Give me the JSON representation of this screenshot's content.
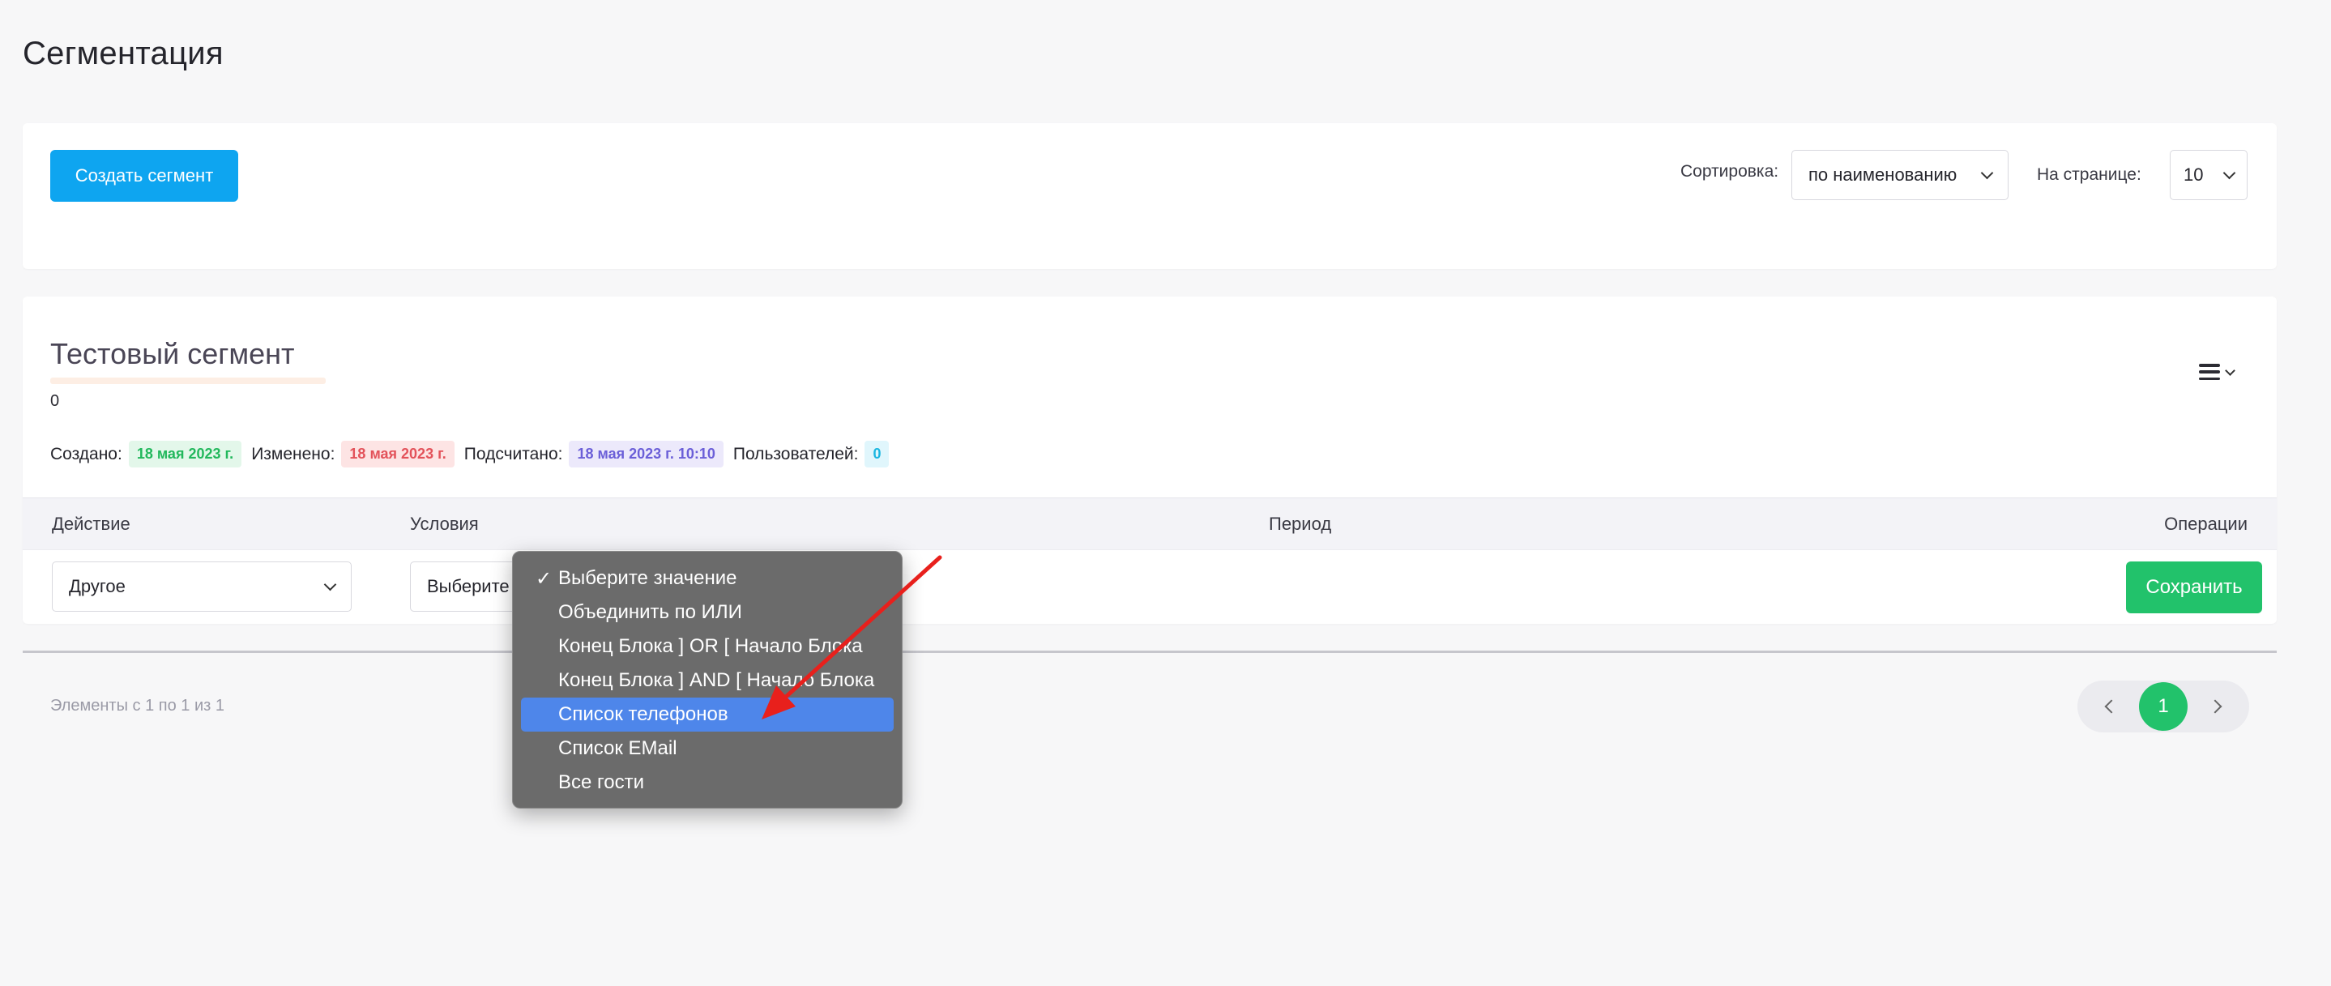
{
  "page": {
    "title": "Сегментация"
  },
  "toolbar": {
    "create_button": "Создать сегмент",
    "sort_label": "Сортировка:",
    "sort_value": "по наименованию",
    "per_page_label": "На странице:",
    "per_page_value": "10"
  },
  "segment": {
    "title": "Тестовый сегмент",
    "count": "0",
    "created_label": "Создано:",
    "created_value": "18 мая 2023 г.",
    "modified_label": "Изменено:",
    "modified_value": "18 мая 2023 г.",
    "calculated_label": "Подсчитано:",
    "calculated_value": "18 мая 2023 г. 10:10",
    "users_label": "Пользователей:",
    "users_value": "0"
  },
  "table": {
    "headers": {
      "action": "Действие",
      "conditions": "Условия",
      "period": "Период",
      "operations": "Операции"
    },
    "row": {
      "action_value": "Другое",
      "condition_value": "Выберите",
      "save_button": "Сохранить"
    }
  },
  "dropdown": {
    "items": [
      {
        "label": "Выберите значение",
        "checked": "✓"
      },
      {
        "label": "Объединить по ИЛИ"
      },
      {
        "label": "Конец Блока ] OR [ Начало Блока"
      },
      {
        "label": "Конец Блока ] AND [ Начало Блока"
      },
      {
        "label": "Список телефонов",
        "highlighted": true
      },
      {
        "label": "Список EMail"
      },
      {
        "label": "Все гости"
      }
    ]
  },
  "footer": {
    "count_text": "Элементы с 1 по 1 из 1",
    "current_page": "1"
  },
  "colors": {
    "primary": "#0ea5f0",
    "success": "#22c26b",
    "highlight": "#4e86ea",
    "annotation_arrow": "#e8201c"
  }
}
